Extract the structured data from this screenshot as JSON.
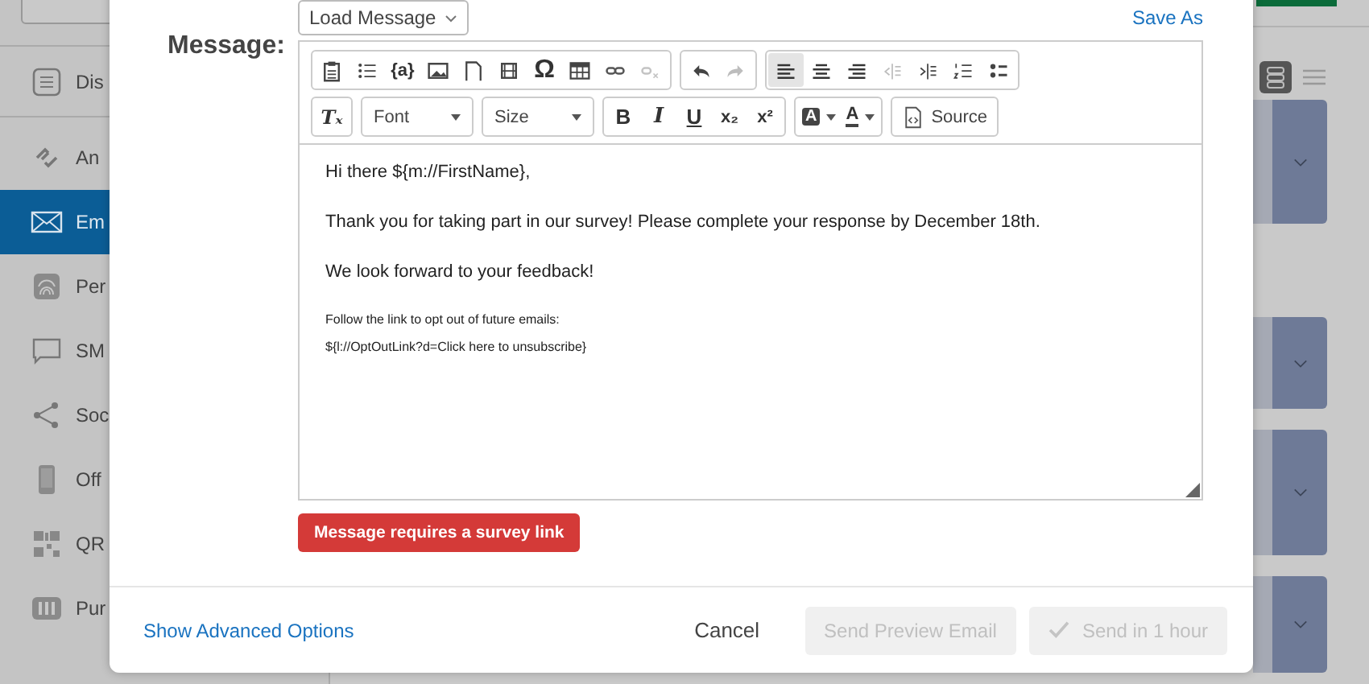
{
  "sidebar": {
    "items": [
      {
        "label": "Dis",
        "selected": false
      },
      {
        "label": "An",
        "selected": false
      },
      {
        "label": "Em",
        "selected": true
      },
      {
        "label": "Per",
        "selected": false
      },
      {
        "label": "SM",
        "selected": false
      },
      {
        "label": "Soc",
        "selected": false
      },
      {
        "label": "Off",
        "selected": false
      },
      {
        "label": "QR",
        "selected": false
      },
      {
        "label": "Pur",
        "selected": false
      }
    ]
  },
  "view_toggle": [
    {
      "kind": "cards",
      "selected": true
    },
    {
      "kind": "lines",
      "selected": false
    }
  ],
  "modal": {
    "message_label": "Message:",
    "load_message": "Load Message",
    "save_as": "Save As",
    "toolbar": [
      [
        {
          "buttons": [
            {
              "kind": "paste",
              "disabled": false,
              "selected": false
            },
            {
              "kind": "bullets",
              "disabled": false,
              "selected": false
            },
            {
              "kind": "text",
              "label": "{a}",
              "disabled": false,
              "selected": false
            },
            {
              "kind": "image",
              "disabled": false,
              "selected": false
            },
            {
              "kind": "page",
              "disabled": false,
              "selected": false
            },
            {
              "kind": "media",
              "disabled": false,
              "selected": false
            },
            {
              "kind": "symbol",
              "label": "Ω",
              "disabled": false,
              "selected": false
            },
            {
              "kind": "table",
              "disabled": false,
              "selected": false
            },
            {
              "kind": "link",
              "disabled": false,
              "selected": false
            },
            {
              "kind": "unlink",
              "disabled": true,
              "selected": false
            }
          ]
        },
        {
          "buttons": [
            {
              "kind": "undo",
              "disabled": false,
              "selected": false
            },
            {
              "kind": "redo",
              "disabled": true,
              "selected": false
            }
          ]
        },
        {
          "buttons": [
            {
              "kind": "alignleft",
              "disabled": false,
              "selected": true
            },
            {
              "kind": "aligncenter",
              "disabled": false,
              "selected": false
            },
            {
              "kind": "alignright",
              "disabled": false,
              "selected": false
            },
            {
              "kind": "outdent",
              "disabled": true,
              "selected": false
            },
            {
              "kind": "indent",
              "disabled": false,
              "selected": false
            },
            {
              "kind": "numbered",
              "disabled": false,
              "selected": false
            },
            {
              "kind": "bulleted",
              "disabled": false,
              "selected": false
            }
          ]
        }
      ],
      [
        {
          "buttons": [
            {
              "kind": "clear",
              "label": "Tₓ",
              "disabled": false,
              "selected": false
            }
          ]
        },
        {
          "buttons": [
            {
              "kind": "dropdown",
              "label": "Font",
              "disabled": false,
              "selected": false
            }
          ]
        },
        {
          "buttons": [
            {
              "kind": "dropdown",
              "label": "Size",
              "disabled": false,
              "selected": false
            }
          ]
        },
        {
          "buttons": [
            {
              "kind": "bold",
              "label": "B",
              "disabled": false,
              "selected": false
            },
            {
              "kind": "italic",
              "label": "I",
              "disabled": false,
              "selected": false
            },
            {
              "kind": "underline",
              "label": "U",
              "disabled": false,
              "selected": false
            },
            {
              "kind": "text",
              "label": "x₂",
              "disabled": false,
              "selected": false
            },
            {
              "kind": "text",
              "label": "x²",
              "disabled": false,
              "selected": false
            }
          ]
        },
        {
          "buttons": [
            {
              "kind": "bgcolor",
              "label": "A",
              "disabled": false,
              "selected": false
            },
            {
              "kind": "fgcolor",
              "label": "A",
              "disabled": false,
              "selected": false
            }
          ]
        },
        {
          "buttons": [
            {
              "kind": "source",
              "label": "Source",
              "disabled": false,
              "selected": false
            }
          ]
        }
      ]
    ],
    "body": [
      {
        "kind": "body",
        "text": "Hi there ${m://FirstName},"
      },
      {
        "kind": "body",
        "text": "Thank you for taking part in our survey! Please complete your response by December 18th."
      },
      {
        "kind": "body",
        "text": "We look forward to your feedback!"
      },
      {
        "kind": "small",
        "text": "Follow the link to opt out of future emails:"
      },
      {
        "kind": "small",
        "text": "${l://OptOutLink?d=Click here to unsubscribe}"
      }
    ],
    "warning": "Message requires a survey link",
    "advanced": "Show Advanced Options",
    "buttons": [
      {
        "label": "Cancel",
        "kind": "plain",
        "disabled": false
      },
      {
        "label": "Send Preview Email",
        "kind": "box",
        "disabled": true
      },
      {
        "label": "Send in 1 hour",
        "kind": "check",
        "disabled": true
      }
    ]
  }
}
